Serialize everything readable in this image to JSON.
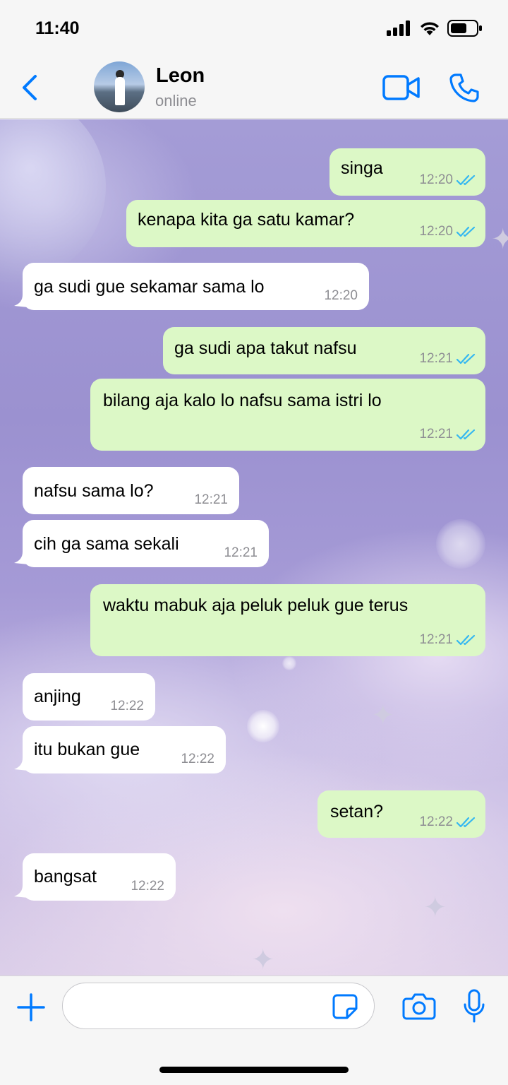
{
  "status_bar": {
    "time": "11:40"
  },
  "header": {
    "contact_name": "Leon",
    "contact_status": "online",
    "icons": {
      "back": "chevron-left-icon",
      "video": "video-camera-icon",
      "call": "phone-icon"
    },
    "accent_color": "#007aff"
  },
  "messages": [
    {
      "direction": "out",
      "text": "singa",
      "time": "12:20",
      "read": true
    },
    {
      "direction": "out",
      "text": "kenapa kita ga satu kamar?",
      "time": "12:20",
      "read": true
    },
    {
      "direction": "in",
      "text": "ga sudi gue sekamar sama lo",
      "time": "12:20"
    },
    {
      "direction": "out",
      "text": "ga sudi apa takut nafsu",
      "time": "12:21",
      "read": true
    },
    {
      "direction": "out",
      "text": "bilang aja kalo lo nafsu sama istri lo",
      "time": "12:21",
      "read": true
    },
    {
      "direction": "in",
      "text": "nafsu sama lo?",
      "time": "12:21"
    },
    {
      "direction": "in",
      "text": "cih ga sama sekali",
      "time": "12:21"
    },
    {
      "direction": "out",
      "text": "waktu mabuk aja peluk peluk gue terus",
      "time": "12:21",
      "read": true
    },
    {
      "direction": "in",
      "text": "anjing",
      "time": "12:22"
    },
    {
      "direction": "in",
      "text": "itu bukan gue",
      "time": "12:22"
    },
    {
      "direction": "out",
      "text": "setan?",
      "time": "12:22",
      "read": true
    },
    {
      "direction": "in",
      "text": "bangsat",
      "time": "12:22"
    }
  ],
  "colors": {
    "outgoing_bubble": "#dcf8c6",
    "incoming_bubble": "#ffffff",
    "read_ticks": "#34b7f1"
  },
  "input": {
    "value": "",
    "placeholder": ""
  }
}
